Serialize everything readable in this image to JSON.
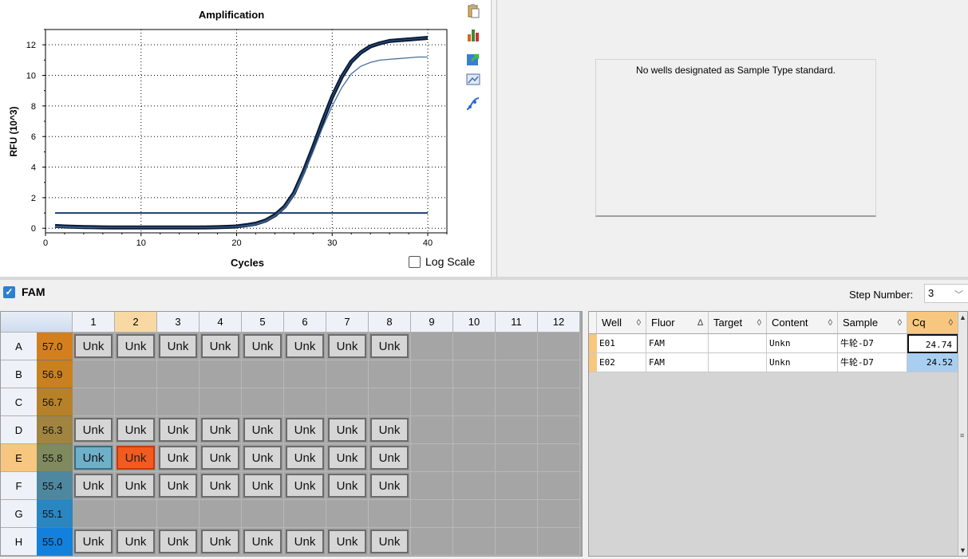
{
  "chart": {
    "title": "Amplification",
    "xlabel": "Cycles",
    "ylabel": "RFU (10^3)",
    "log_scale_label": "Log Scale"
  },
  "toolbar_icons": [
    "copy-icon",
    "chart-bars-icon",
    "export-icon",
    "image-settings-icon",
    "curve-icon"
  ],
  "chart_data": {
    "type": "line",
    "xlim": [
      0,
      42
    ],
    "ylim": [
      -0.3,
      13
    ],
    "x_ticks": [
      0,
      10,
      20,
      30,
      40
    ],
    "y_ticks": [
      0,
      2,
      4,
      6,
      8,
      10,
      12
    ],
    "grid": true,
    "threshold": 1.0,
    "series": [
      {
        "x": [
          1,
          2,
          3,
          4,
          5,
          6,
          7,
          8,
          9,
          10,
          11,
          12,
          13,
          14,
          15,
          16,
          17,
          18,
          19,
          20,
          21,
          22,
          23,
          24,
          25,
          26,
          27,
          28,
          29,
          30,
          31,
          32,
          33,
          34,
          35,
          36,
          37,
          38,
          39,
          40
        ],
        "values": [
          0.15,
          0.12,
          0.1,
          0.08,
          0.07,
          0.06,
          0.05,
          0.05,
          0.05,
          0.05,
          0.05,
          0.05,
          0.05,
          0.05,
          0.05,
          0.05,
          0.06,
          0.07,
          0.09,
          0.12,
          0.2,
          0.3,
          0.5,
          0.85,
          1.4,
          2.3,
          3.7,
          5.3,
          7.0,
          8.6,
          9.9,
          10.9,
          11.5,
          11.9,
          12.1,
          12.25,
          12.3,
          12.35,
          12.4,
          12.45
        ]
      },
      {
        "x": [
          1,
          2,
          3,
          4,
          5,
          6,
          7,
          8,
          9,
          10,
          11,
          12,
          13,
          14,
          15,
          16,
          17,
          18,
          19,
          20,
          21,
          22,
          23,
          24,
          25,
          26,
          27,
          28,
          29,
          30,
          31,
          32,
          33,
          34,
          35,
          36,
          37,
          38,
          39,
          40
        ],
        "values": [
          0.1,
          0.08,
          0.06,
          0.05,
          0.05,
          0.05,
          0.05,
          0.05,
          0.05,
          0.05,
          0.05,
          0.05,
          0.05,
          0.05,
          0.05,
          0.05,
          0.05,
          0.06,
          0.08,
          0.1,
          0.15,
          0.25,
          0.45,
          0.8,
          1.3,
          2.2,
          3.5,
          5.0,
          6.6,
          8.0,
          9.2,
          10.1,
          10.6,
          10.85,
          11.0,
          11.05,
          11.1,
          11.15,
          11.2,
          11.2
        ]
      }
    ]
  },
  "standard_message": "No wells designated as Sample Type standard.",
  "fluor": {
    "label": "FAM",
    "step_label": "Step Number:",
    "step_value": "3"
  },
  "plate": {
    "columns": [
      "1",
      "2",
      "3",
      "4",
      "5",
      "6",
      "7",
      "8",
      "9",
      "10",
      "11",
      "12"
    ],
    "rows": [
      {
        "label": "A",
        "temp": "57.0",
        "color": "#d47f1e",
        "wells": [
          "Unk",
          "Unk",
          "Unk",
          "Unk",
          "Unk",
          "Unk",
          "Unk",
          "Unk",
          "",
          "",
          "",
          ""
        ]
      },
      {
        "label": "B",
        "temp": "56.9",
        "color": "#c9801f",
        "wells": [
          "",
          "",
          "",
          "",
          "",
          "",
          "",
          "",
          "",
          "",
          "",
          ""
        ]
      },
      {
        "label": "C",
        "temp": "56.7",
        "color": "#b7812a",
        "wells": [
          "",
          "",
          "",
          "",
          "",
          "",
          "",
          "",
          "",
          "",
          "",
          ""
        ]
      },
      {
        "label": "D",
        "temp": "56.3",
        "color": "#a08440",
        "wells": [
          "Unk",
          "Unk",
          "Unk",
          "Unk",
          "Unk",
          "Unk",
          "Unk",
          "Unk",
          "",
          "",
          "",
          ""
        ]
      },
      {
        "label": "E",
        "temp": "55.8",
        "color": "#7f8a5e",
        "wells": [
          "Unk",
          "Unk",
          "Unk",
          "Unk",
          "Unk",
          "Unk",
          "Unk",
          "Unk",
          "",
          "",
          "",
          ""
        ]
      },
      {
        "label": "F",
        "temp": "55.4",
        "color": "#4e88a0",
        "wells": [
          "Unk",
          "Unk",
          "Unk",
          "Unk",
          "Unk",
          "Unk",
          "Unk",
          "Unk",
          "",
          "",
          "",
          ""
        ]
      },
      {
        "label": "G",
        "temp": "55.1",
        "color": "#2a86c0",
        "wells": [
          "",
          "",
          "",
          "",
          "",
          "",
          "",
          "",
          "",
          "",
          "",
          ""
        ]
      },
      {
        "label": "H",
        "temp": "55.0",
        "color": "#1280dc",
        "wells": [
          "Unk",
          "Unk",
          "Unk",
          "Unk",
          "Unk",
          "Unk",
          "Unk",
          "Unk",
          "",
          "",
          "",
          ""
        ]
      }
    ]
  },
  "table": {
    "headers": [
      "Well",
      "Fluor",
      "Target",
      "Content",
      "Sample",
      "Cq"
    ],
    "rows": [
      {
        "well": "E01",
        "fluor": "FAM",
        "target": "",
        "content": "Unkn",
        "sample": "牛轮-D7",
        "cq": "24.74"
      },
      {
        "well": "E02",
        "fluor": "FAM",
        "target": "",
        "content": "Unkn",
        "sample": "牛轮-D7",
        "cq": "24.52"
      }
    ]
  }
}
